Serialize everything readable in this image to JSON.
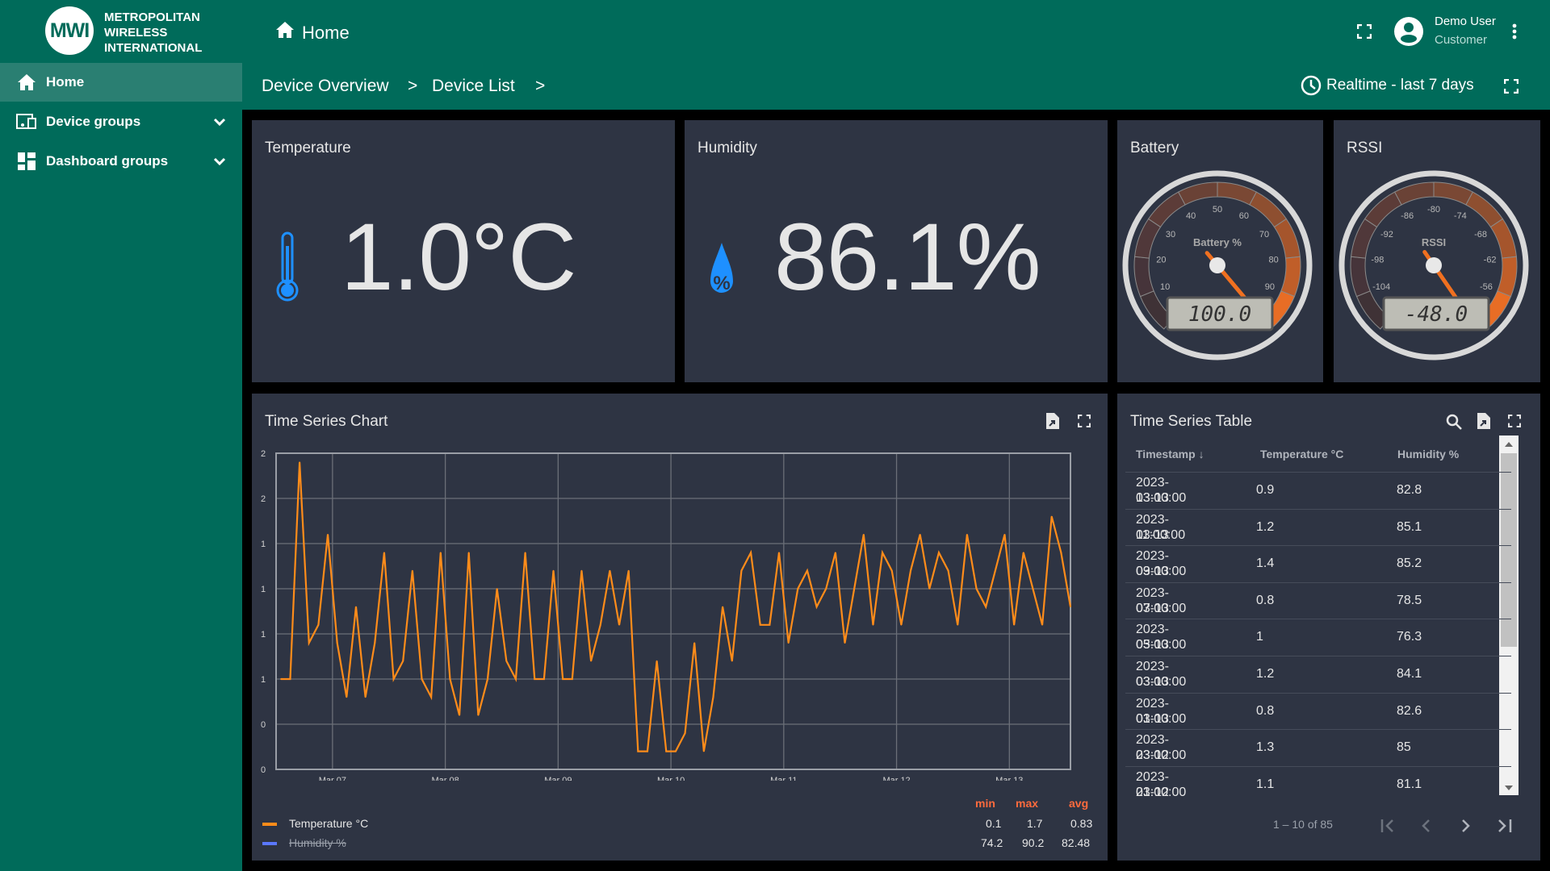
{
  "brand": {
    "logo_text": "MWI",
    "name_lines": [
      "METROPOLITAN",
      "WIRELESS",
      "INTERNATIONAL"
    ]
  },
  "sidebar": {
    "items": [
      {
        "label": "Home",
        "icon": "home-icon",
        "active": true
      },
      {
        "label": "Device groups",
        "icon": "devices-icon",
        "expandable": true
      },
      {
        "label": "Dashboard groups",
        "icon": "dashboard-icon",
        "expandable": true
      }
    ]
  },
  "header": {
    "title": "Home",
    "breadcrumb": [
      "Device Overview",
      "Device List"
    ],
    "separator": ">",
    "user_name": "Demo User",
    "user_role": "Customer",
    "timewindow": "Realtime - last 7 days"
  },
  "colors": {
    "header": "#006b5a",
    "card": "#2e3443",
    "accent_blue": "#1e90ff",
    "series_temperature": "#ff8c1a",
    "series_humidity": "#5a78ff",
    "stat_label": "#ff6b3d"
  },
  "widgets": {
    "temperature": {
      "title": "Temperature",
      "value": "1.0°C"
    },
    "humidity": {
      "title": "Humidity",
      "value": "86.1%"
    },
    "battery": {
      "title": "Battery",
      "label": "Battery %",
      "min": 0,
      "max": 100,
      "value": 100,
      "display": "100.0",
      "ticks": [
        "0",
        "10",
        "20",
        "30",
        "40",
        "50",
        "60",
        "70",
        "80",
        "90",
        "100"
      ]
    },
    "rssi": {
      "title": "RSSI",
      "label": "RSSI",
      "min": -110,
      "max": -50,
      "value": -48,
      "display": "-48.0",
      "ticks": [
        "-110",
        "-104",
        "-98",
        "-92",
        "-86",
        "-80",
        "-74",
        "-68",
        "-62",
        "-56",
        "-50"
      ]
    }
  },
  "chart": {
    "title": "Time Series Chart",
    "legend_headers": [
      "min",
      "max",
      "avg"
    ],
    "legend": [
      {
        "name": "Temperature °C",
        "min": "0.1",
        "max": "1.7",
        "avg": "0.83",
        "hidden": false
      },
      {
        "name": "Humidity %",
        "min": "74.2",
        "max": "90.2",
        "avg": "82.48",
        "hidden": true
      }
    ]
  },
  "chart_data": {
    "type": "line",
    "title": "",
    "xlabel": "",
    "ylabel": "",
    "x_start": "2023-03-06 13:00",
    "x_step_hours": 2,
    "x_range": [
      "2023-03-06 12:00",
      "2023-03-13 13:00"
    ],
    "ylim": [
      0,
      1.75
    ],
    "y_ticks": [
      0,
      0.25,
      0.5,
      0.75,
      1,
      1.25,
      1.5,
      1.75
    ],
    "y_tick_labels": [
      "0",
      "0",
      "1",
      "1",
      "1",
      "1",
      "2",
      "2"
    ],
    "x_ticks": [
      "Mar 07",
      "Mar 08",
      "Mar 09",
      "Mar 10",
      "Mar 11",
      "Mar 12",
      "Mar 13"
    ],
    "grid": true,
    "legend_position": "bottom",
    "series": [
      {
        "name": "Temperature °C",
        "values": [
          0.5,
          0.5,
          1.7,
          0.7,
          0.8,
          1.3,
          0.7,
          0.4,
          0.9,
          0.4,
          0.7,
          1.2,
          0.5,
          0.6,
          1.1,
          0.5,
          0.4,
          1.2,
          0.5,
          0.3,
          1.2,
          0.3,
          0.5,
          1.0,
          0.6,
          0.5,
          1.2,
          0.5,
          0.5,
          1.1,
          0.5,
          0.5,
          1.1,
          0.6,
          0.8,
          1.1,
          0.8,
          1.1,
          0.1,
          0.1,
          0.6,
          0.1,
          0.1,
          0.2,
          0.7,
          0.1,
          0.4,
          0.9,
          0.6,
          1.1,
          1.2,
          0.8,
          0.8,
          1.2,
          0.7,
          1.0,
          1.1,
          0.9,
          1.0,
          1.2,
          0.7,
          1.0,
          1.3,
          0.8,
          1.2,
          1.1,
          0.8,
          1.1,
          1.3,
          1.0,
          1.2,
          1.1,
          0.8,
          1.3,
          1.0,
          0.9,
          1.1,
          1.3,
          0.8,
          1.2,
          1.0,
          0.8,
          1.4,
          1.2,
          0.9
        ]
      }
    ]
  },
  "table": {
    "title": "Time Series Table",
    "columns": [
      "Timestamp",
      "Temperature °C",
      "Humidity %"
    ],
    "rows": [
      [
        "2023-03-13",
        "13:00:00",
        "0.9",
        "82.8"
      ],
      [
        "2023-03-13",
        "11:00:00",
        "1.2",
        "85.1"
      ],
      [
        "2023-03-13",
        "09:00:00",
        "1.4",
        "85.2"
      ],
      [
        "2023-03-13",
        "07:00:00",
        "0.8",
        "78.5"
      ],
      [
        "2023-03-13",
        "05:00:00",
        "1",
        "76.3"
      ],
      [
        "2023-03-13",
        "03:00:00",
        "1.2",
        "84.1"
      ],
      [
        "2023-03-13",
        "01:00:00",
        "0.8",
        "82.6"
      ],
      [
        "2023-03-12",
        "23:00:00",
        "1.3",
        "85"
      ],
      [
        "2023-03-12",
        "21:00:00",
        "1.1",
        "81.1"
      ]
    ],
    "pagination": "1 – 10 of 85"
  }
}
